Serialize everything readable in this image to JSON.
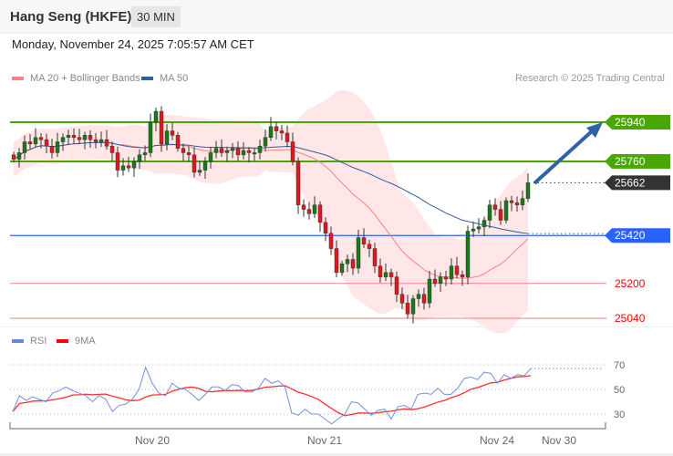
{
  "header": {
    "title": "Hang Seng (HKFE)",
    "timeframe": "30 MIN",
    "datetime": "Monday, November 24, 2025 7:05:57 AM CET"
  },
  "legend": {
    "ma20": "MA 20 + Bollinger Bands",
    "ma50": "MA 50",
    "rsi": "RSI",
    "rsi_ma": "9MA",
    "credit": "Research © 2025 Trading Central"
  },
  "colors": {
    "up": "#1a7a1a",
    "down": "#e0191f",
    "resistance": "#4aa600",
    "support": "#2962ff",
    "target_red": "#ff0000",
    "last": "#333333",
    "ma20": "#ff8080",
    "ma50": "#3060a0"
  },
  "chart_data": [
    {
      "type": "candlestick",
      "title": "Hang Seng (HKFE) 30 MIN",
      "ylim": [
        24975,
        26060
      ],
      "levels": [
        {
          "label": "25940",
          "value": 25940,
          "kind": "resistance"
        },
        {
          "label": "25760",
          "value": 25760,
          "kind": "resistance"
        },
        {
          "label": "25662",
          "value": 25662,
          "kind": "last"
        },
        {
          "label": "25420",
          "value": 25420,
          "kind": "pivot"
        },
        {
          "label": "25200",
          "value": 25200,
          "kind": "support"
        },
        {
          "label": "25040",
          "value": 25040,
          "kind": "support"
        }
      ],
      "closes": [
        25770,
        25800,
        25850,
        25840,
        25870,
        25860,
        25830,
        25800,
        25850,
        25870,
        25880,
        25870,
        25860,
        25880,
        25860,
        25850,
        25860,
        25830,
        25800,
        25720,
        25740,
        25730,
        25760,
        25790,
        25800,
        25940,
        25990,
        25840,
        25900,
        25880,
        25820,
        25800,
        25790,
        25710,
        25720,
        25760,
        25800,
        25820,
        25800,
        25810,
        25820,
        25790,
        25810,
        25800,
        25800,
        25830,
        25870,
        25920,
        25900,
        25890,
        25850,
        25760,
        25560,
        25540,
        25520,
        25560,
        25480,
        25430,
        25360,
        25250,
        25290,
        25310,
        25270,
        25410,
        25380,
        25360,
        25280,
        25230,
        25250,
        25230,
        25150,
        25110,
        25060,
        25130,
        25150,
        25110,
        25220,
        25200,
        25230,
        25220,
        25280,
        25240,
        25230,
        25440,
        25450,
        25460,
        25490,
        25560,
        25540,
        25490,
        25580,
        25570,
        25560,
        25590,
        25662
      ],
      "x_ticks": [
        "Nov 20",
        "Nov 21",
        "Nov 24",
        "Nov 30"
      ]
    },
    {
      "type": "line",
      "title": "RSI",
      "ylim": [
        20,
        75
      ],
      "y_ticks": [
        "70",
        "50",
        "30"
      ],
      "rsi": [
        32,
        45,
        41,
        44,
        42,
        40,
        47,
        49,
        52,
        49,
        47,
        45,
        40,
        45,
        42,
        32,
        37,
        38,
        42,
        50,
        68,
        55,
        47,
        45,
        55,
        51,
        50,
        46,
        41,
        46,
        52,
        52,
        49,
        54,
        53,
        48,
        48,
        51,
        59,
        55,
        57,
        52,
        31,
        29,
        34,
        30,
        30,
        26,
        22,
        26,
        30,
        40,
        39,
        34,
        29,
        33,
        34,
        26,
        36,
        37,
        34,
        46,
        47,
        46,
        51,
        46,
        46,
        51,
        59,
        60,
        58,
        64,
        63,
        55,
        62,
        59,
        62,
        61,
        67
      ]
    }
  ]
}
